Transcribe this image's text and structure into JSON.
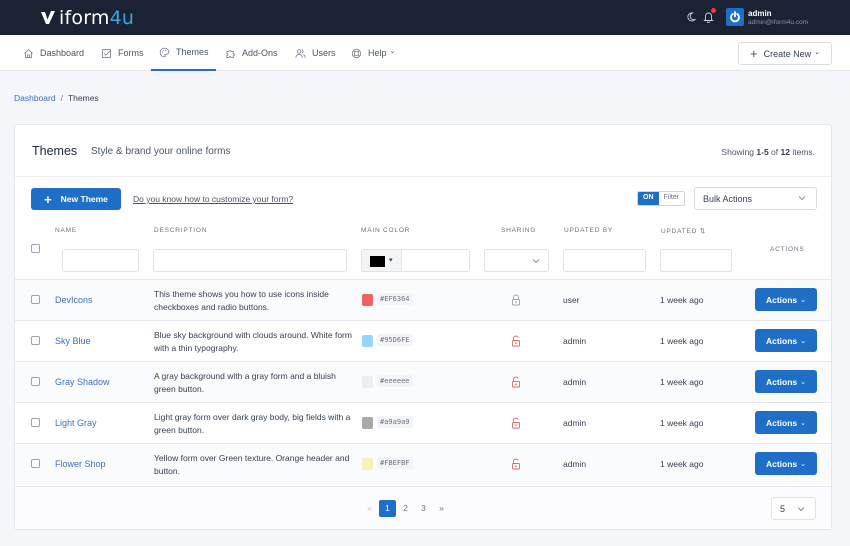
{
  "app": {
    "logo_main": "iform",
    "logo_accent": "4u",
    "user": {
      "name": "admin",
      "email": "admin@iform4u.com"
    },
    "notifications_unread": true
  },
  "nav": {
    "items": [
      {
        "label": "Dashboard",
        "icon": "home-icon",
        "active": false
      },
      {
        "label": "Forms",
        "icon": "forms-icon",
        "active": false
      },
      {
        "label": "Themes",
        "icon": "palette-icon",
        "active": true
      },
      {
        "label": "Add-Ons",
        "icon": "puzzle-icon",
        "active": false
      },
      {
        "label": "Users",
        "icon": "users-icon",
        "active": false
      },
      {
        "label": "Help",
        "icon": "lifebuoy-icon",
        "active": false,
        "dropdown": true
      }
    ],
    "help_caret": "⌄",
    "create_new_label": "Create New",
    "create_new_caret": "⌄"
  },
  "breadcrumb": {
    "items": [
      "Dashboard",
      "Themes"
    ],
    "separator": "/"
  },
  "page": {
    "title": "Themes",
    "subtitle": "Style & brand your online forms",
    "showing_prefix": "Showing ",
    "showing_range": "1-5",
    "showing_of": " of ",
    "showing_total": "12",
    "showing_suffix": " items."
  },
  "toolbar": {
    "new_theme_label": "New Theme",
    "help_link": "Do you know how to customize your form?",
    "filter_on": "ON",
    "filter_label": "Filter",
    "bulk_actions": "Bulk Actions"
  },
  "table": {
    "columns": {
      "name": "NAME",
      "description": "DESCRIPTION",
      "main_color": "MAIN COLOR",
      "sharing": "SHARING",
      "updated_by": "UPDATED BY",
      "updated": "UPDATED",
      "updated_sort": "⇅",
      "actions": "ACTIONS"
    },
    "filters": {
      "name": "",
      "description": "",
      "main_color": "",
      "main_color_swatch": "#000000",
      "sharing": "",
      "updated_by": "",
      "updated": ""
    },
    "rows": [
      {
        "name": "DevIcons",
        "description": "This theme shows you how to use icons inside checkboxes and radio buttons.",
        "color": "#EF6364",
        "color_label": "#EF6364",
        "sharing": "locked",
        "sharing_color": "#9ca3af",
        "updated_by": "user",
        "updated": "1 week ago",
        "action_label": "Actions"
      },
      {
        "name": "Sky Blue",
        "description": "Blue sky background with clouds around. White form with a thin typography.",
        "color": "#95D6FE",
        "color_label": "#95D6FE",
        "sharing": "unlocked",
        "sharing_color": "#e06b6b",
        "updated_by": "admin",
        "updated": "1 week ago",
        "action_label": "Actions"
      },
      {
        "name": "Gray Shadow",
        "description": "A gray background with a gray form and a bluish green button.",
        "color": "#eeeeee",
        "color_label": "#eeeeee",
        "sharing": "unlocked",
        "sharing_color": "#e06b6b",
        "updated_by": "admin",
        "updated": "1 week ago",
        "action_label": "Actions"
      },
      {
        "name": "Light Gray",
        "description": "Light gray form over dark gray body, big fields with a green button.",
        "color": "#a9a9a9",
        "color_label": "#a9a9a9",
        "sharing": "unlocked",
        "sharing_color": "#e06b6b",
        "updated_by": "admin",
        "updated": "1 week ago",
        "action_label": "Actions"
      },
      {
        "name": "Flower Shop",
        "description": "Yellow form over Green texture. Orange header and button.",
        "color": "#FBEFBF",
        "color_label": "#FBEFBF",
        "sharing": "unlocked",
        "sharing_color": "#e06b6b",
        "updated_by": "admin",
        "updated": "1 week ago",
        "action_label": "Actions"
      }
    ]
  },
  "pagination": {
    "prev": "«",
    "pages": [
      "1",
      "2",
      "3"
    ],
    "current": "1",
    "next": "»",
    "per_page": "5"
  },
  "colors": {
    "primary": "#1f6fc8",
    "topbar": "#1a2233",
    "link": "#3b6fc0",
    "logo_accent": "#39a6ec",
    "notification": "#e53e3e"
  }
}
